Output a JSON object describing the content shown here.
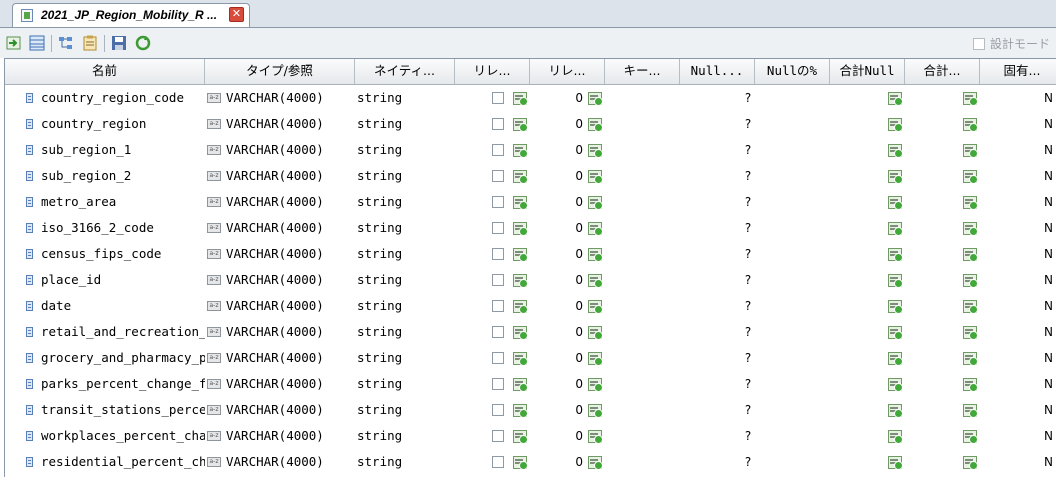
{
  "tab": {
    "title": "2021_JP_Region_Mobility_R ...",
    "close_label": "✕"
  },
  "toolbar": {
    "buttons": [
      "import-icon",
      "table-icon",
      "tree-icon",
      "properties-icon",
      "save-icon",
      "refresh-icon"
    ],
    "design_mode_label": "設計モード"
  },
  "columns": [
    "名前",
    "タイプ/参照",
    "ネイティ...",
    "リレ...",
    "リレ...",
    "キー...",
    "Null...",
    "Nullの%",
    "合計Null",
    "合計...",
    "固有..."
  ],
  "rows": [
    {
      "name": "country_region_code",
      "type": "VARCHAR(4000)",
      "native": "string",
      "rel": "0",
      "nullp": "?",
      "unique": "N"
    },
    {
      "name": "country_region",
      "type": "VARCHAR(4000)",
      "native": "string",
      "rel": "0",
      "nullp": "?",
      "unique": "N"
    },
    {
      "name": "sub_region_1",
      "type": "VARCHAR(4000)",
      "native": "string",
      "rel": "0",
      "nullp": "?",
      "unique": "N"
    },
    {
      "name": "sub_region_2",
      "type": "VARCHAR(4000)",
      "native": "string",
      "rel": "0",
      "nullp": "?",
      "unique": "N"
    },
    {
      "name": "metro_area",
      "type": "VARCHAR(4000)",
      "native": "string",
      "rel": "0",
      "nullp": "?",
      "unique": "N"
    },
    {
      "name": "iso_3166_2_code",
      "type": "VARCHAR(4000)",
      "native": "string",
      "rel": "0",
      "nullp": "?",
      "unique": "N"
    },
    {
      "name": "census_fips_code",
      "type": "VARCHAR(4000)",
      "native": "string",
      "rel": "0",
      "nullp": "?",
      "unique": "N"
    },
    {
      "name": "place_id",
      "type": "VARCHAR(4000)",
      "native": "string",
      "rel": "0",
      "nullp": "?",
      "unique": "N"
    },
    {
      "name": "date",
      "type": "VARCHAR(4000)",
      "native": "string",
      "rel": "0",
      "nullp": "?",
      "unique": "N"
    },
    {
      "name": "retail_and_recreation_percent_change_from_baseline",
      "type": "VARCHAR(4000)",
      "native": "string",
      "rel": "0",
      "nullp": "?",
      "unique": "N"
    },
    {
      "name": "grocery_and_pharmacy_percent_change_from_baseline",
      "type": "VARCHAR(4000)",
      "native": "string",
      "rel": "0",
      "nullp": "?",
      "unique": "N"
    },
    {
      "name": "parks_percent_change_from_baseline",
      "type": "VARCHAR(4000)",
      "native": "string",
      "rel": "0",
      "nullp": "?",
      "unique": "N"
    },
    {
      "name": "transit_stations_percent_change_from_baseline",
      "type": "VARCHAR(4000)",
      "native": "string",
      "rel": "0",
      "nullp": "?",
      "unique": "N"
    },
    {
      "name": "workplaces_percent_change_from_baseline",
      "type": "VARCHAR(4000)",
      "native": "string",
      "rel": "0",
      "nullp": "?",
      "unique": "N"
    },
    {
      "name": "residential_percent_change_from_baseline",
      "type": "VARCHAR(4000)",
      "native": "string",
      "rel": "0",
      "nullp": "?",
      "unique": "N"
    }
  ]
}
